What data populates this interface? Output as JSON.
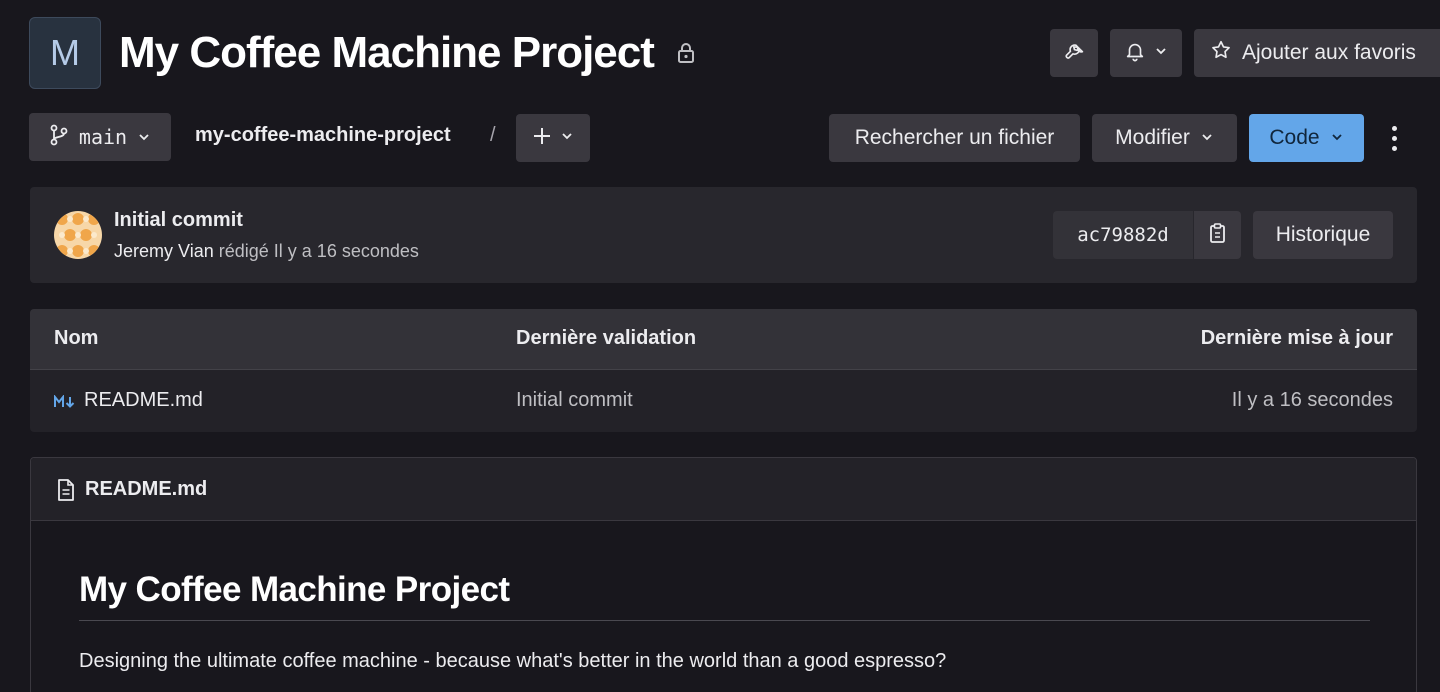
{
  "project": {
    "avatar_letter": "M",
    "title": "My Coffee Machine Project"
  },
  "header_actions": {
    "favorite_label": "Ajouter aux favoris"
  },
  "toolbar": {
    "branch": "main",
    "breadcrumb": "my-coffee-machine-project",
    "separator": "/",
    "find_file_label": "Rechercher un fichier",
    "edit_label": "Modifier",
    "code_label": "Code"
  },
  "commit": {
    "title": "Initial commit",
    "author": "Jeremy Vian",
    "action": "rédigé",
    "time": "Il y a 16 secondes",
    "sha": "ac79882d",
    "history_label": "Historique"
  },
  "files": {
    "columns": [
      "Nom",
      "Dernière validation",
      "Dernière mise à jour"
    ],
    "rows": [
      {
        "name": "README.md",
        "last_commit": "Initial commit",
        "updated": "Il y a 16 secondes"
      }
    ]
  },
  "readme": {
    "filename": "README.md",
    "heading": "My Coffee Machine Project",
    "paragraph": "Designing the ultimate coffee machine - because what's better in the world than a good espresso?"
  },
  "colors": {
    "background": "#18171d",
    "surface": "#28272d",
    "button": "#3a383f",
    "primary": "#63a6e9",
    "markdown_icon": "#63a6e9"
  }
}
